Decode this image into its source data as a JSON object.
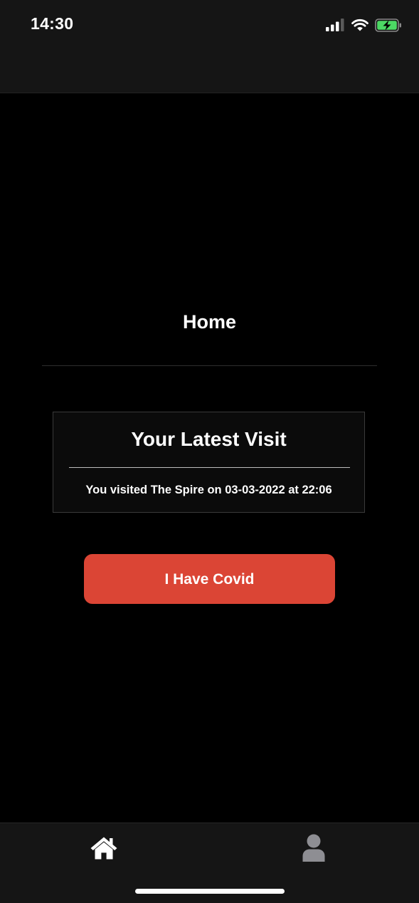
{
  "status_bar": {
    "time": "14:30",
    "icons": [
      "cellular-signal-icon",
      "wifi-icon",
      "battery-charging-icon"
    ]
  },
  "page": {
    "title": "Home"
  },
  "visit_card": {
    "title": "Your Latest Visit",
    "text": "You visited The Spire on 03-03-2022 at 22:06"
  },
  "actions": {
    "covid_button_label": "I Have Covid"
  },
  "tab_bar": {
    "items": [
      {
        "icon": "home-icon",
        "active": true
      },
      {
        "icon": "user-icon",
        "active": false
      }
    ]
  },
  "colors": {
    "accent": "#db4535",
    "background": "#000000",
    "bar_background": "#151515",
    "battery_green": "#4cd964",
    "inactive_icon": "#8e8e93"
  }
}
